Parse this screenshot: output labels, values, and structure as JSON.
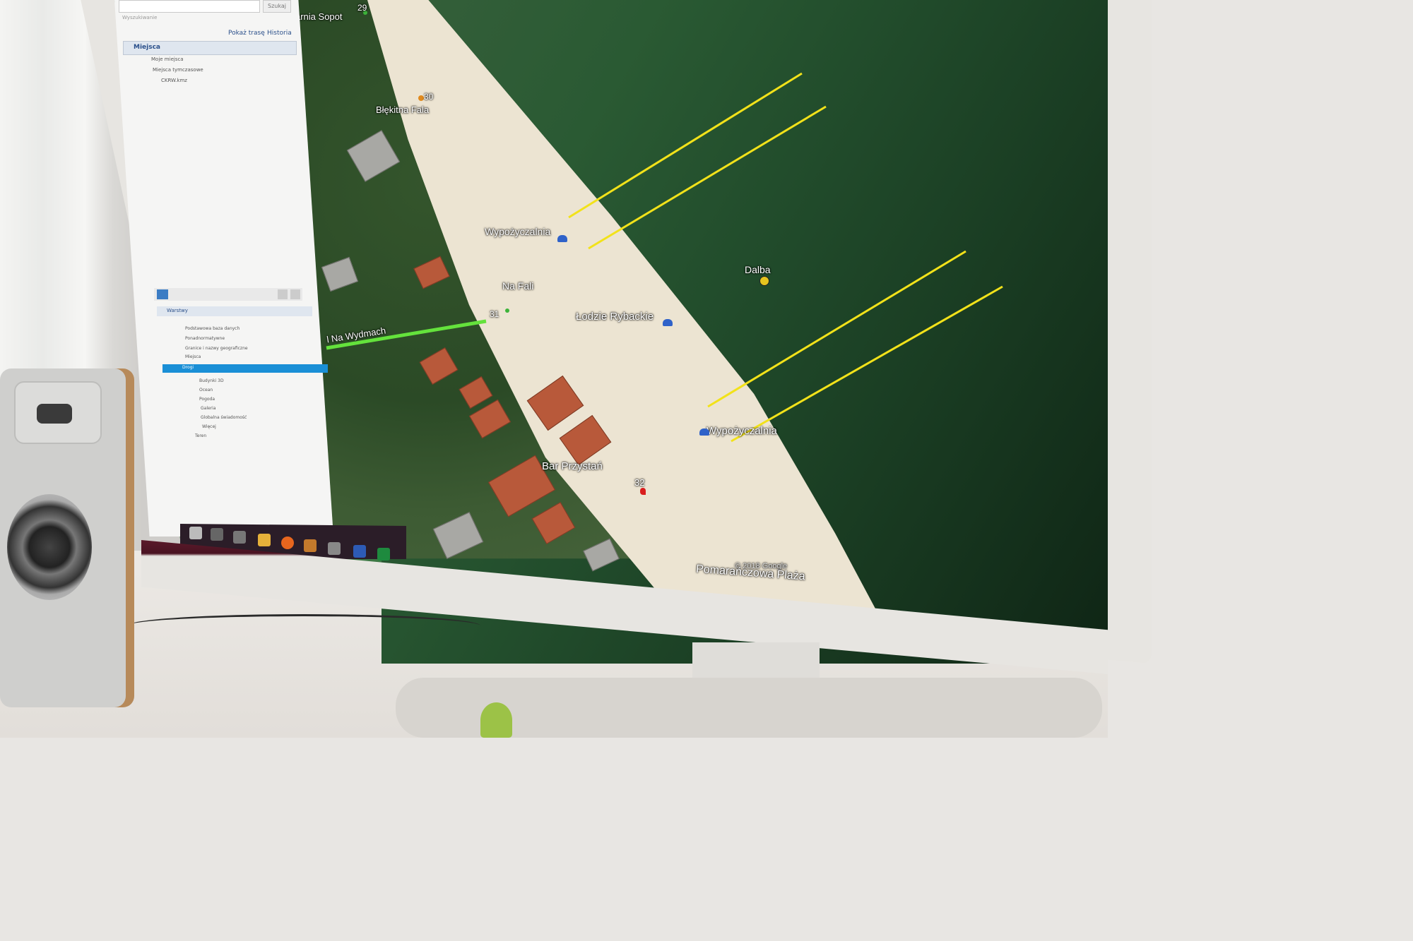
{
  "sidebar": {
    "search_placeholder": "Wyszukiwanie",
    "search_button": "Szukaj",
    "links": {
      "show_route": "Pokaż trasę",
      "history": "Historia"
    },
    "places_header": "Miejsca",
    "places_items": [
      "Moje miejsca",
      "Miejsca tymczasowe",
      "CKRW.kmz"
    ],
    "layers_header": "Warstwy",
    "layers_items": [
      "Podstawowa baza danych",
      "Ponadnormatywne",
      "Granice i nazwy geograficzne",
      "Miejsca",
      "Drogi",
      "Budynki 3D",
      "Ocean",
      "Pogoda",
      "Galeria",
      "Globalna świadomość",
      "Więcej",
      "Teren"
    ]
  },
  "map": {
    "labels": {
      "sopot": "arnia Sopot",
      "num29": "29",
      "blekitna": "Błękitna Fala",
      "num30": "30",
      "wypozyczalnia1": "Wypożyczalnia",
      "na_fali": "Na Fali",
      "num31": "31",
      "na_wydmach": "l Na Wydmach",
      "lodzie": "Łodzie Rybackie",
      "dalba": "Dalba",
      "wypozyczalnia2": "Wypożyczalnia",
      "bar_przystan": "Bar Przystań",
      "num32": "32",
      "pomaranczowa": "Pomarańczowa Plaża",
      "copyright": "© 2018 Google"
    }
  },
  "colors": {
    "yellow_line": "#f2e21a",
    "green_route": "#64e23c",
    "bezel": "#e7e5e1"
  }
}
